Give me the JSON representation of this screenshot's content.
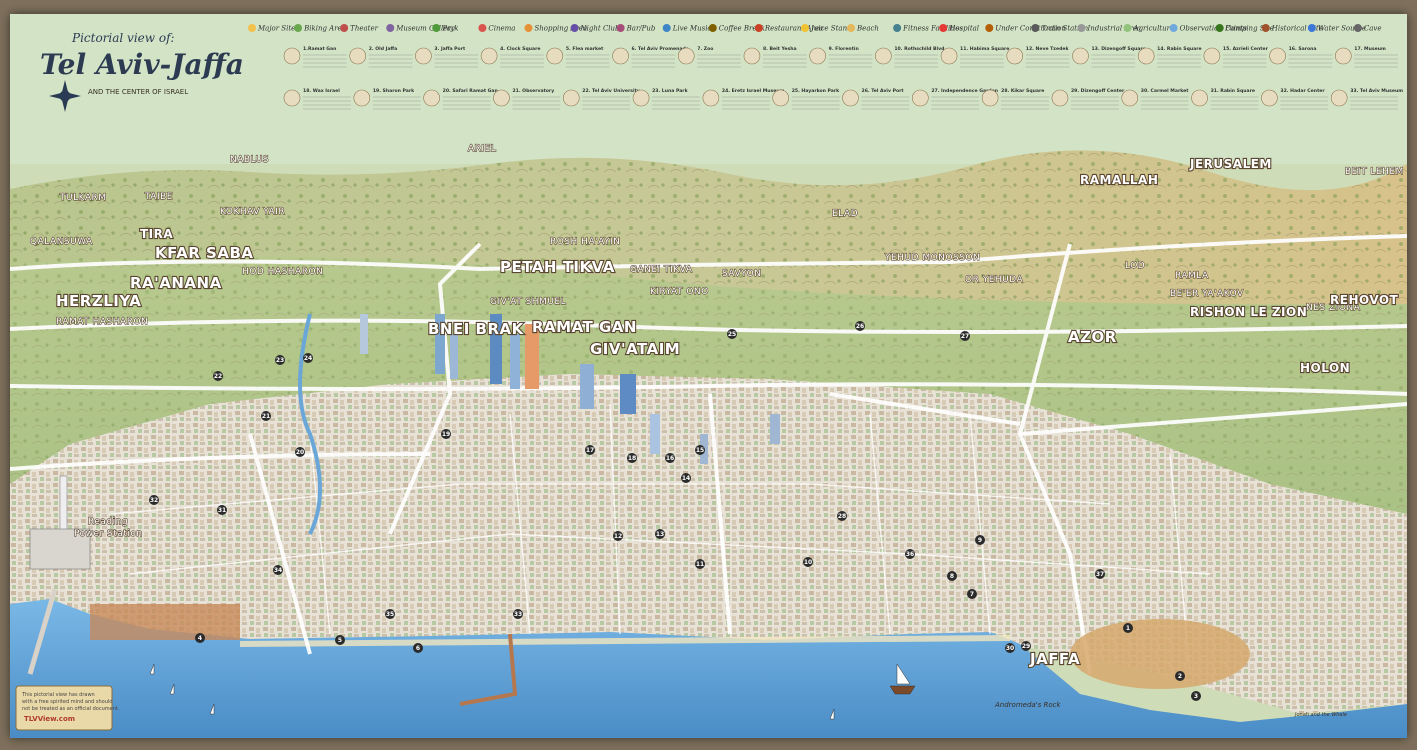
{
  "title": {
    "line1": "Pictorial view of:",
    "line2": "Tel Aviv-Jaffa",
    "line3": "AND THE CENTER OF ISRAEL"
  },
  "legend": {
    "categories": [
      {
        "label": "Major Site",
        "color": "#f2c14e"
      },
      {
        "label": "Biking Area",
        "color": "#6aa84f"
      },
      {
        "label": "Theater",
        "color": "#c0504d"
      },
      {
        "label": "Museum Gallery",
        "color": "#8064a2"
      },
      {
        "label": "Park",
        "color": "#4f9a3a"
      },
      {
        "label": "Cinema",
        "color": "#d9534f"
      },
      {
        "label": "Shopping Area",
        "color": "#e69138"
      },
      {
        "label": "Night Club",
        "color": "#674ea7"
      },
      {
        "label": "Bar/Pub",
        "color": "#a64d79"
      },
      {
        "label": "Live Music",
        "color": "#3d85c6"
      },
      {
        "label": "Coffee Break",
        "color": "#7f6000"
      },
      {
        "label": "Restaurant Area",
        "color": "#cc4125"
      },
      {
        "label": "Juice Stand",
        "color": "#f1c232"
      },
      {
        "label": "Beach",
        "color": "#e6b85c"
      },
      {
        "label": "Fitness Facilities",
        "color": "#45818e"
      },
      {
        "label": "Hospital",
        "color": "#e53935"
      },
      {
        "label": "Under Construction",
        "color": "#b45f06"
      },
      {
        "label": "Train Station",
        "color": "#5b5b5b"
      },
      {
        "label": "Industrial Area",
        "color": "#999999"
      },
      {
        "label": "Agriculture",
        "color": "#93c47d"
      },
      {
        "label": "Observation Points",
        "color": "#6fa8dc"
      },
      {
        "label": "Camping Site",
        "color": "#38761d"
      },
      {
        "label": "Historical Site",
        "color": "#a0522d"
      },
      {
        "label": "Water Source",
        "color": "#3c78d8"
      },
      {
        "label": "Cave",
        "color": "#666666"
      }
    ],
    "entries_row1": [
      "1.Ramat Gan",
      "2. Old Jaffa",
      "3. Jaffa Port",
      "4. Clock Square",
      "5. Flea market",
      "6. Tel Aviv Promenade",
      "7. Zoo",
      "8. Beit Yesha",
      "9. Florentin",
      "10. Rothschild Blvd",
      "11. Habima Square",
      "12. Neve Tzedek",
      "13. Dizengoff Square",
      "14. Rabin Square",
      "15. Azrieli Center",
      "16. Sarona",
      "17. Museum"
    ],
    "entries_row2": [
      "18. Wax Israel",
      "19. Sharon Park",
      "20. Safari Ramat Gan",
      "21. Observatory",
      "22. Tel Aviv University",
      "23. Luna Park",
      "24. Eretz Israel Museum",
      "25. Hayarkon Park",
      "26. Tel Aviv Port",
      "27. Independence Garden",
      "28. Kikar Square",
      "29. Dizengoff Center",
      "30. Carmel Market",
      "31. Rabin Square",
      "32. Hadar Center",
      "33. Tel Aviv Museum"
    ]
  },
  "places": {
    "nablus": "NABLUS",
    "ariel": "ARIEL",
    "jerusalem": "JERUSALEM",
    "beit_lehem": "BEIT LEHEM",
    "tulkarm": "TULKARM",
    "taibe": "TAIBE",
    "kokhav_yair": "KOKHAV YAIR",
    "tira": "TIRA",
    "qalansuwa": "QALANSUWA",
    "kfar_saba": "KFAR SABA",
    "hod_hasharon": "HOD HASHARON",
    "raanana": "RA'ANANA",
    "herzliya": "HERZLIYA",
    "ramat_hasharon": "RAMAT HASHARON",
    "elad": "ELAD",
    "rosh_haayin": "ROSH HA'AYIN",
    "ramallah": "RAMALLAH",
    "petah_tikva": "PETAH TIKVA",
    "ganei_tikva": "GANEI TIKVA",
    "savyon": "SAVYON",
    "kiryat_ono": "KIRYAT ONO",
    "yehud": "YEHUD MONOSSON",
    "or_yehuda": "OR YEHUDA",
    "lod": "LOD",
    "ramla": "RAMLA",
    "beer_yaakov": "BE'ER YA'AKOV",
    "givat_shmuel": "GIV'AT SHMUEL",
    "bnei_brak": "BNEI BRAK",
    "ramat_gan": "RAMAT GAN",
    "givatayim": "GIV'ATAIM",
    "azor": "AZOR",
    "rishon": "RISHON LE ZION",
    "ness_ziona": "NES ZIONA",
    "rehovot": "REHOVOT",
    "holon": "HOLON",
    "jaffa": "JAFFA",
    "reading_1": "Reading",
    "reading_2": "Power Station",
    "andromeda": "Andromeda's Rock",
    "jonah": "Jonah and the Whale"
  },
  "poi_numbers": [
    "1",
    "2",
    "3",
    "4",
    "5",
    "6",
    "7",
    "8",
    "9",
    "10",
    "11",
    "12",
    "13",
    "14",
    "15",
    "16",
    "17",
    "18",
    "19",
    "20",
    "21",
    "22",
    "23",
    "24",
    "25",
    "26",
    "27",
    "28",
    "29",
    "30",
    "31",
    "32",
    "33",
    "34",
    "35",
    "36",
    "37"
  ],
  "disclaimer": {
    "text1": "This pictorial view has drawn",
    "text2": "with a free spirited mind and should",
    "text3": "not be treated as an official document.",
    "site": "TLVView.com"
  },
  "colors": {
    "sea": "#5d9fd6",
    "sky": "#cfe3c4",
    "legend_bg": "#d6e8c7",
    "hills": "#d5cd9d",
    "city": "#e9e4dc"
  }
}
